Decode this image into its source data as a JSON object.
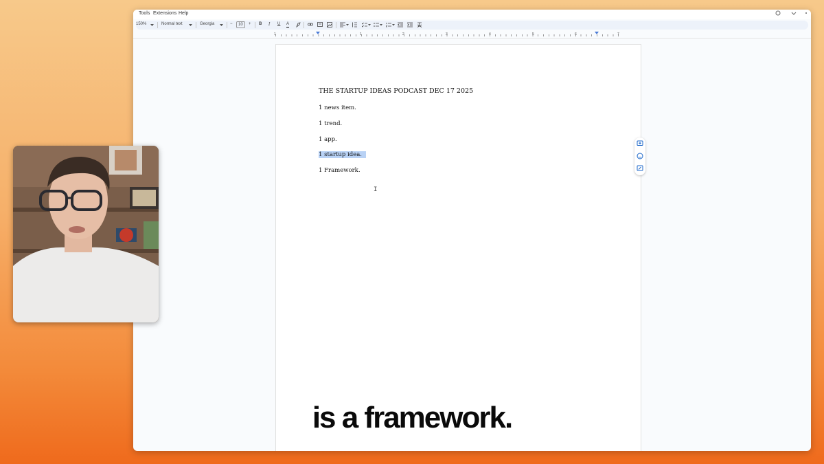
{
  "menubar": {
    "items": [
      "Tools",
      "Extensions",
      "Help"
    ]
  },
  "toolbar": {
    "zoom": "150%",
    "style": "Normal text",
    "font": "Georgia",
    "minus": "−",
    "size": "10",
    "plus": "+",
    "bold": "B",
    "italic": "I",
    "underline": "U",
    "text_color": "A"
  },
  "ruler": {
    "labels": [
      "1",
      "1",
      "2",
      "3",
      "4",
      "5",
      "6",
      "7"
    ]
  },
  "document": {
    "title": "THE STARTUP IDEAS PODCAST DEC 17 2025",
    "lines": [
      "1 news item.",
      "1 trend.",
      "1 app.",
      "1 startup idea.",
      "1 Framework."
    ]
  },
  "cursor_glyph": "I",
  "caption": "is a framework.",
  "colors": {
    "selection": "#b9d2f5",
    "accent": "#4a7bd6"
  }
}
